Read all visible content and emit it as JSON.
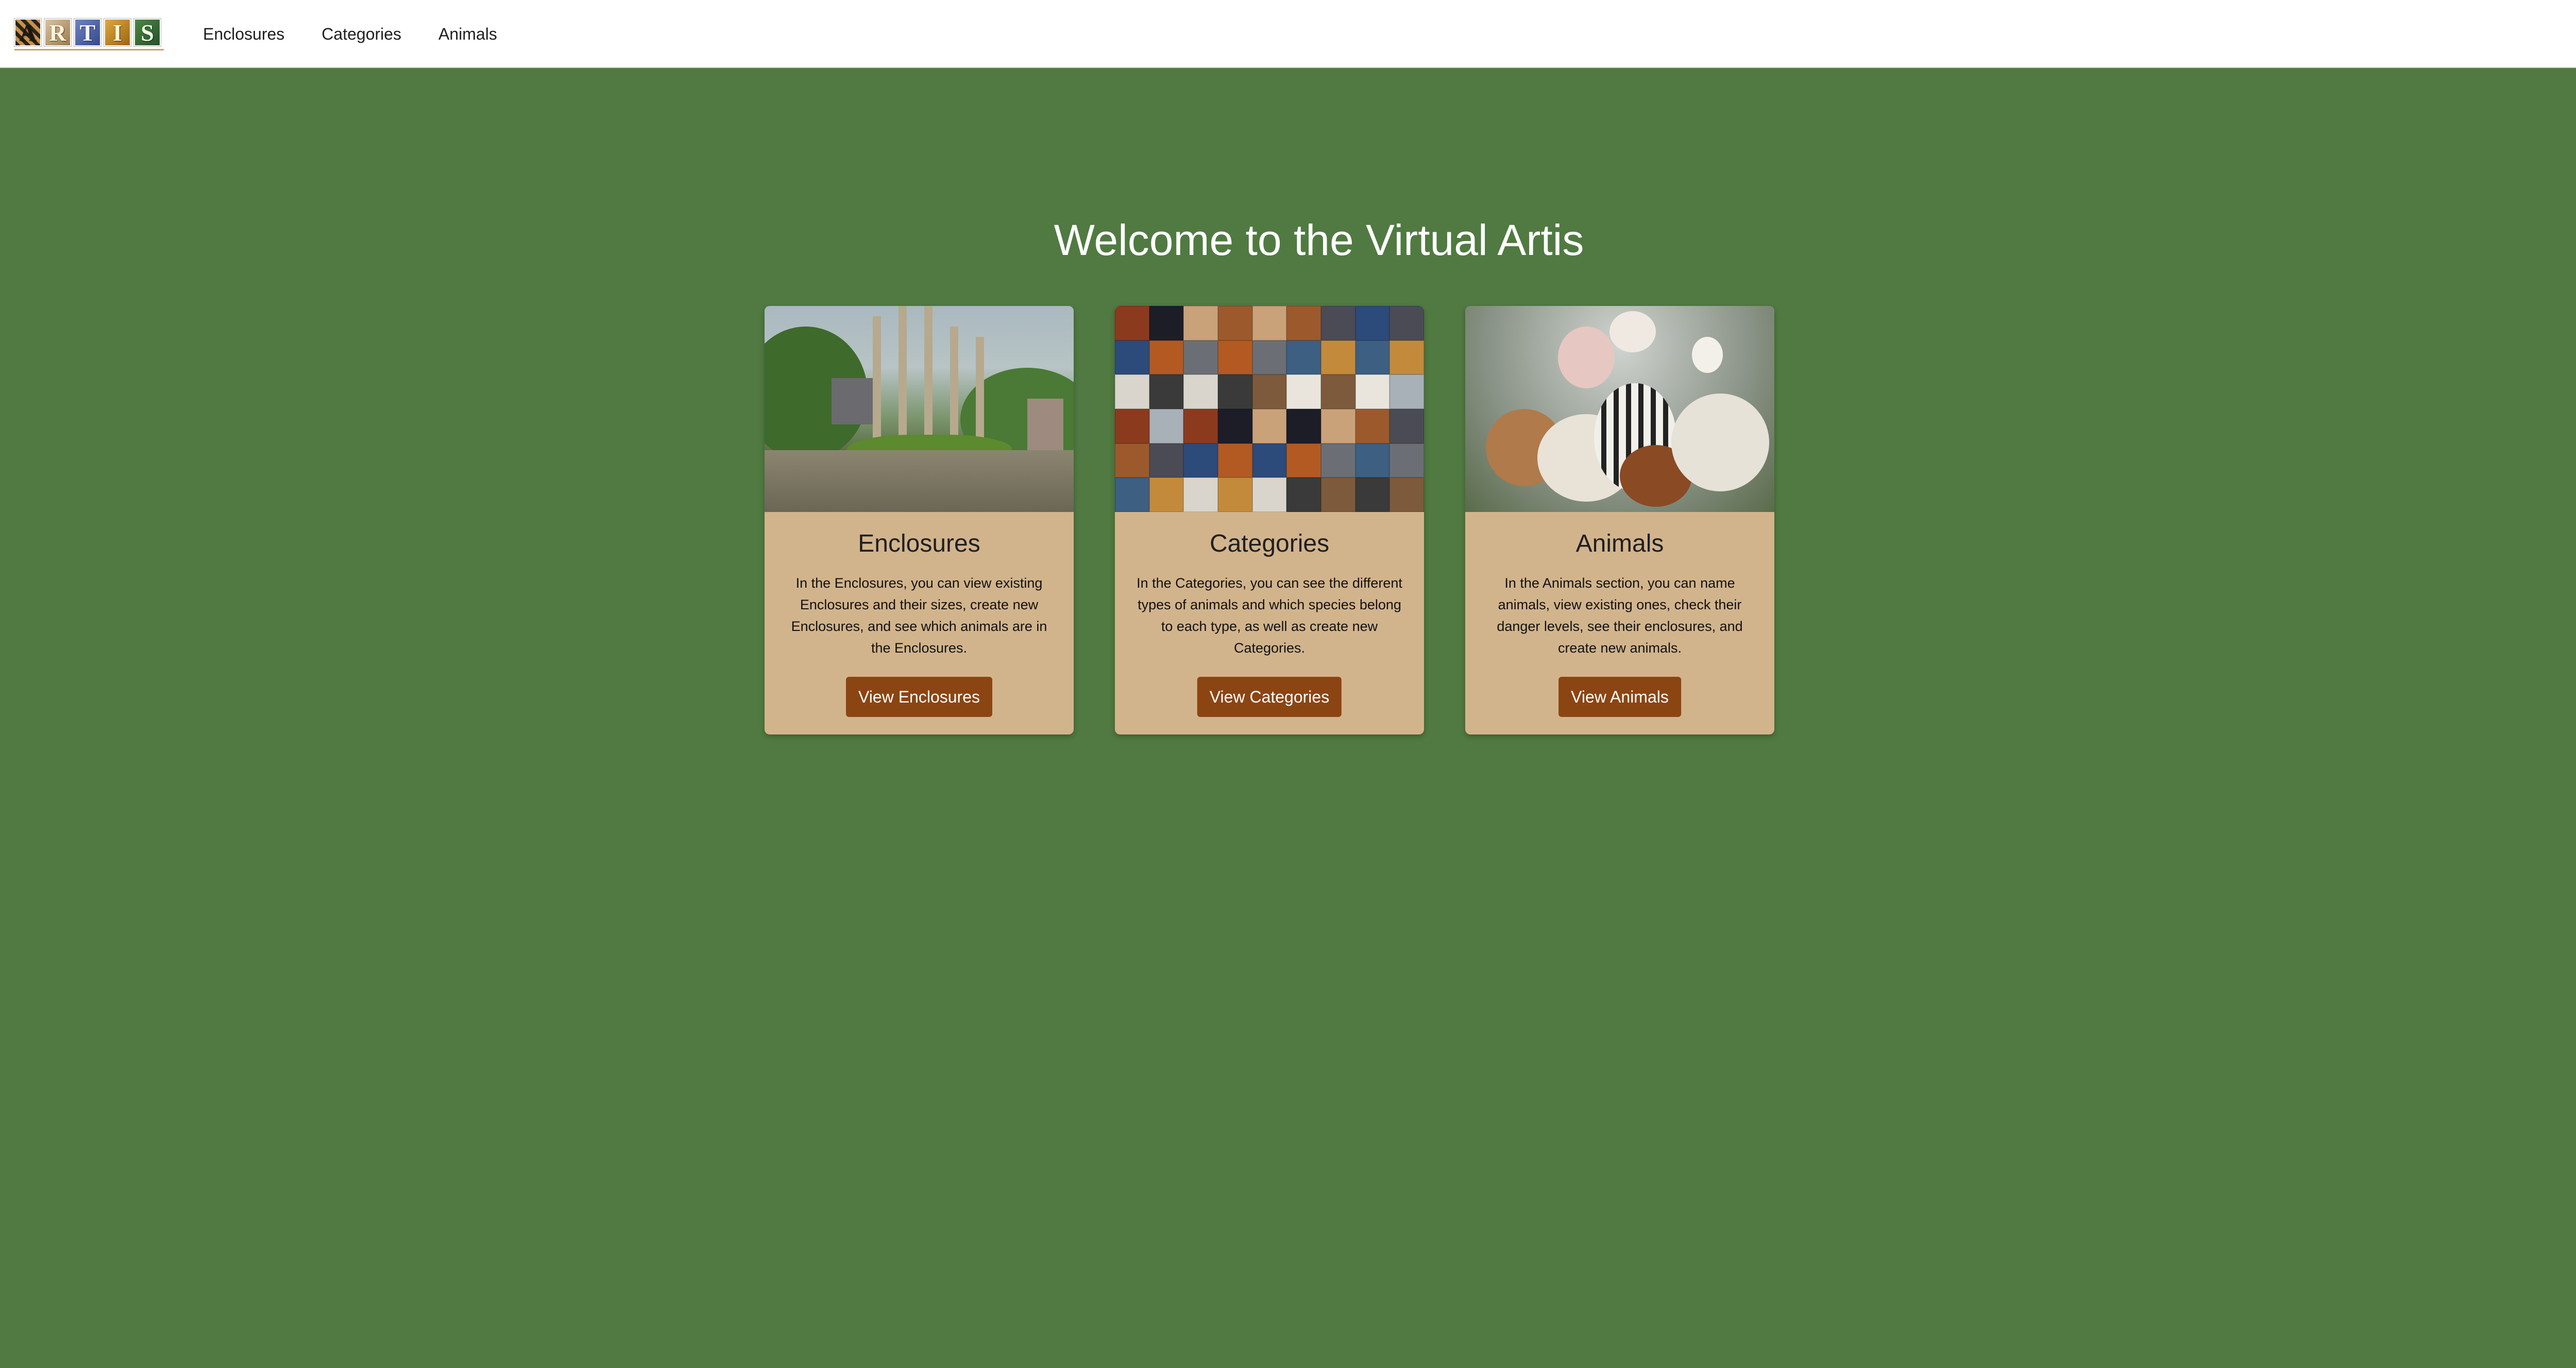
{
  "navbar": {
    "logo_letters": [
      "A",
      "R",
      "T",
      "I",
      "S"
    ],
    "links": [
      {
        "label": "Enclosures"
      },
      {
        "label": "Categories"
      },
      {
        "label": "Animals"
      }
    ]
  },
  "hero": {
    "title": "Welcome to the Virtual Artis"
  },
  "cards": [
    {
      "title": "Enclosures",
      "text": "In the Enclosures, you can view existing Enclosures and their sizes, create new Enclosures, and see which animals are in the Enclosures.",
      "button": "View Enclosures"
    },
    {
      "title": "Categories",
      "text": "In the Categories, you can see the different types of animals and which species belong to each type, as well as create new Categories.",
      "button": "View Categories"
    },
    {
      "title": "Animals",
      "text": "In the Animals section, you can name animals, view existing ones, check their danger levels, see their enclosures, and create new animals.",
      "button": "View Animals"
    }
  ],
  "colors": {
    "page_background": "#507a41",
    "card_background": "#d2b48c",
    "button_background": "#8b4513",
    "navbar_background": "#ffffff"
  }
}
